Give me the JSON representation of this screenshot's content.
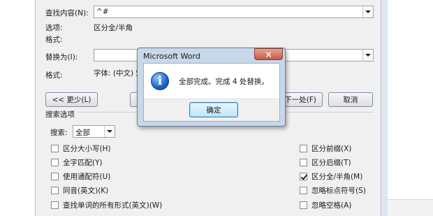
{
  "find": {
    "find_what_label": "查找内容(N):",
    "find_what_value": "^#",
    "options_label": "选项:",
    "options_value": "区分全/半角",
    "format_label": "格式:"
  },
  "replace": {
    "replace_with_label": "替换为(I):",
    "replace_with_value": "",
    "format_label": "格式:",
    "format_value": "字体: (中文) 宋"
  },
  "buttons": {
    "less": "<< 更少(L)",
    "find_next": "下一处(F)",
    "cancel": "取消"
  },
  "search_options": {
    "section_label": "搜索选项",
    "search_label": "搜索:",
    "search_value": "全部"
  },
  "left_checkboxes": [
    {
      "label": "区分大小写(H)",
      "checked": false
    },
    {
      "label": "全字匹配(Y)",
      "checked": false
    },
    {
      "label": "使用通配符(U)",
      "checked": false
    },
    {
      "label": "同音(英文)(K)",
      "checked": false
    },
    {
      "label": "查找单词的所有形式(英文)(W)",
      "checked": false
    }
  ],
  "right_checkboxes": [
    {
      "label": "区分前缀(X)",
      "checked": false
    },
    {
      "label": "区分后缀(T)",
      "checked": false
    },
    {
      "label": "区分全/半角(M)",
      "checked": true
    },
    {
      "label": "忽略标点符号(S)",
      "checked": false
    },
    {
      "label": "忽略空格(A)",
      "checked": false
    }
  ],
  "message_box": {
    "title": "Microsoft Word",
    "close_symbol": "×",
    "icon_glyph": "i",
    "message": "全部完成。完成 4 处替换。",
    "ok_label": "确定"
  }
}
